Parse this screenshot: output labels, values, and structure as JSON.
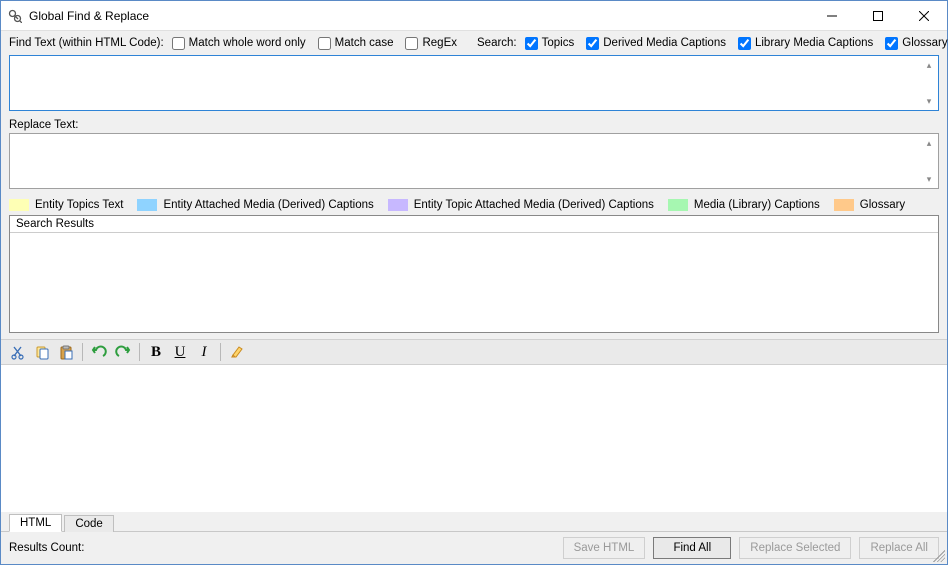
{
  "window": {
    "title": "Global Find & Replace"
  },
  "options": {
    "find_label": "Find Text (within HTML Code):",
    "match_whole": "Match whole word only",
    "match_case": "Match case",
    "regex": "RegEx",
    "search_label": "Search:",
    "topics": "Topics",
    "derived_captions": "Derived Media Captions",
    "library_captions": "Library Media Captions",
    "glossary": "Glossary",
    "checked": {
      "match_whole": false,
      "match_case": false,
      "regex": false,
      "topics": true,
      "derived_captions": true,
      "library_captions": true,
      "glossary": true
    }
  },
  "find": {
    "value": ""
  },
  "replace": {
    "label": "Replace Text:",
    "value": ""
  },
  "legend": {
    "entity_topics": "Entity Topics Text",
    "entity_attached": "Entity Attached Media (Derived) Captions",
    "entity_topic_attached": "Entity Topic Attached Media (Derived) Captions",
    "media_library": "Media (Library) Captions",
    "glossary": "Glossary"
  },
  "results": {
    "header": "Search Results"
  },
  "tabs": {
    "html": "HTML",
    "code": "Code",
    "active": "html"
  },
  "footer": {
    "results_count_label": "Results Count:",
    "save_html": "Save HTML",
    "find_all": "Find All",
    "replace_selected": "Replace Selected",
    "replace_all": "Replace All"
  }
}
